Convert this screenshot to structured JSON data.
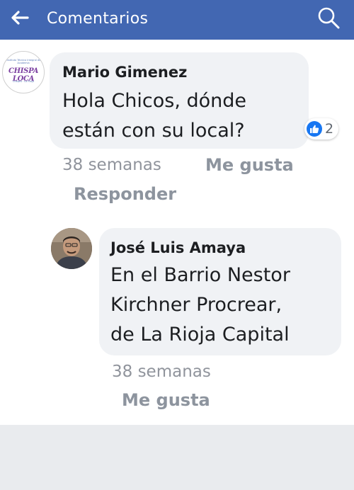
{
  "header": {
    "title": "Comentarios",
    "back_icon": "arrow-left-icon",
    "search_icon": "search-icon",
    "background": "#4267b2"
  },
  "comments": [
    {
      "author": "Mario Gimenez",
      "avatar_logo_text": "CHISPA LOCA",
      "avatar_logo_top": "Instituto Técnico Integral de Academia",
      "avatar_logo_bottom": "Chepes · La Rioja",
      "lines": [
        "Hola Chicos, dónde",
        "están con su local?"
      ],
      "reaction_icon": "thumbs-up-icon",
      "reaction_count": "2",
      "time": "38 semanas",
      "like_label": "Me gusta",
      "reply_label": "Responder"
    },
    {
      "author": "José Luis Amaya",
      "lines": [
        "En el Barrio Nestor",
        "Kirchner Procrear,",
        "de La Rioja Capital"
      ],
      "time": "38 semanas",
      "like_label": "Me gusta"
    }
  ]
}
